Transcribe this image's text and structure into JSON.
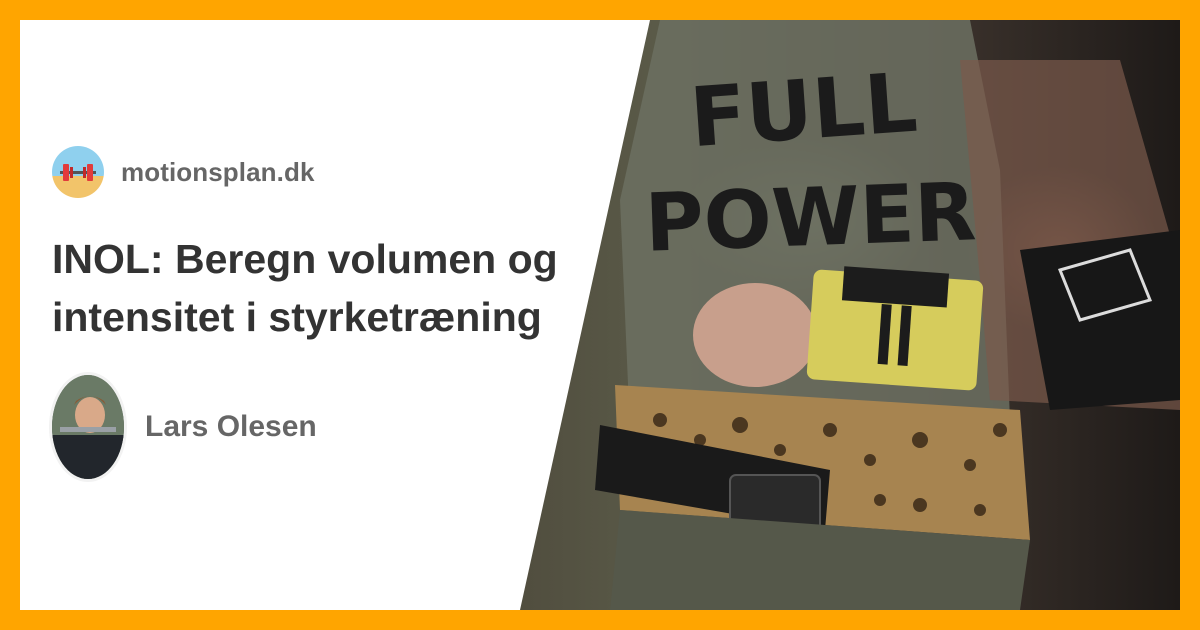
{
  "site": {
    "name": "motionsplan.dk",
    "icon": "barbell-beach-icon"
  },
  "article": {
    "title": "INOL: Beregn volumen og intensitet i styrketræning"
  },
  "author": {
    "name": "Lars Olesen",
    "avatar": "author-photo"
  },
  "photo": {
    "shirt_text_line1": "FULL",
    "shirt_text_line2": "POWER"
  },
  "colors": {
    "border": "#FFA500",
    "background": "#FFFFFF",
    "title": "#333333",
    "meta_text": "#666666"
  }
}
